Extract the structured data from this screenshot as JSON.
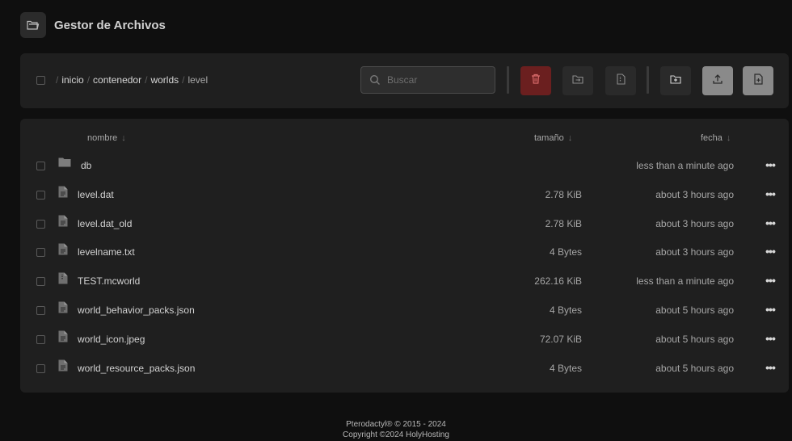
{
  "header": {
    "title": "Gestor de Archivos",
    "icon": "folder-open-icon"
  },
  "toolbar": {
    "breadcrumb": {
      "separator": "/",
      "items": [
        "inicio",
        "contenedor",
        "worlds",
        "level"
      ]
    },
    "search": {
      "placeholder": "Buscar",
      "value": ""
    },
    "buttons": {
      "delete": {
        "icon": "trash-icon",
        "color": "#6b1f1f"
      },
      "move": {
        "icon": "folder-move-icon"
      },
      "archive": {
        "icon": "file-archive-icon"
      },
      "new_folder": {
        "icon": "folder-plus-icon"
      },
      "upload": {
        "icon": "upload-icon"
      },
      "new_file": {
        "icon": "file-plus-icon"
      }
    }
  },
  "table": {
    "columns": {
      "name": "nombre",
      "size": "tamaño",
      "date": "fecha",
      "sort_arrow": "↓"
    },
    "rows": [
      {
        "type": "folder",
        "name": "db",
        "size": "",
        "date": "less than a minute ago"
      },
      {
        "type": "file",
        "name": "level.dat",
        "size": "2.78 KiB",
        "date": "about 3 hours ago"
      },
      {
        "type": "file",
        "name": "level.dat_old",
        "size": "2.78 KiB",
        "date": "about 3 hours ago"
      },
      {
        "type": "file",
        "name": "levelname.txt",
        "size": "4 Bytes",
        "date": "about 3 hours ago"
      },
      {
        "type": "archive",
        "name": "TEST.mcworld",
        "size": "262.16 KiB",
        "date": "less than a minute ago"
      },
      {
        "type": "file",
        "name": "world_behavior_packs.json",
        "size": "4 Bytes",
        "date": "about 5 hours ago"
      },
      {
        "type": "file",
        "name": "world_icon.jpeg",
        "size": "72.07 KiB",
        "date": "about 5 hours ago"
      },
      {
        "type": "file",
        "name": "world_resource_packs.json",
        "size": "4 Bytes",
        "date": "about 5 hours ago"
      }
    ]
  },
  "footer": {
    "line1": "Pterodactyl® © 2015 - 2024",
    "line2": "Copyright ©2024 HolyHosting"
  }
}
